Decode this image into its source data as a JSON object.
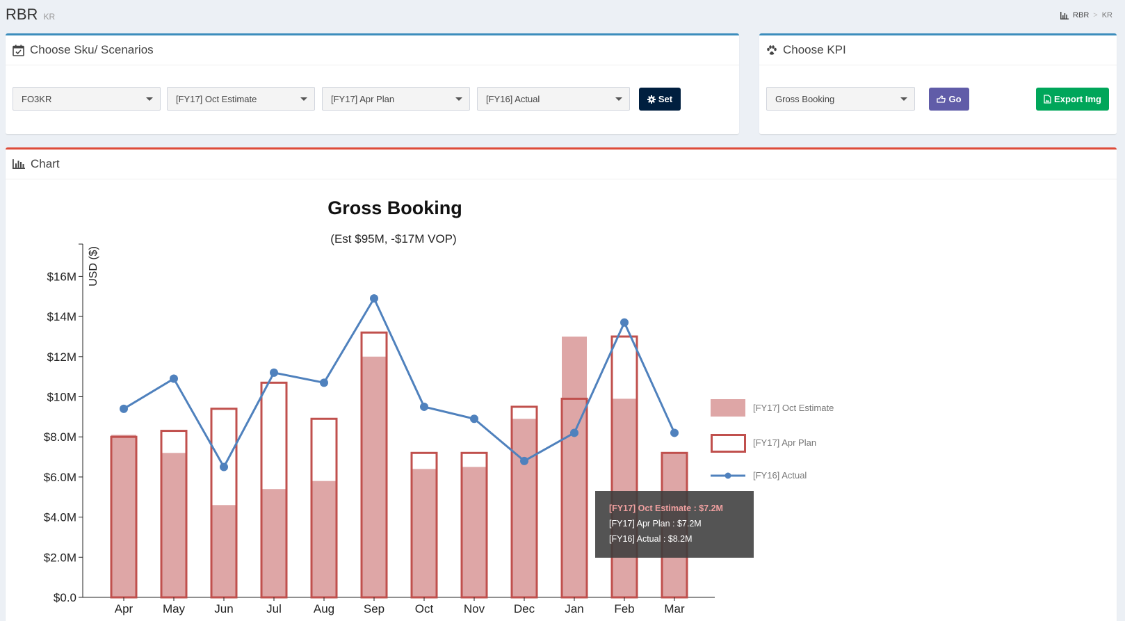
{
  "header": {
    "title": "RBR",
    "subtitle": "KR"
  },
  "breadcrumb": {
    "items": [
      "RBR",
      "KR"
    ]
  },
  "sku_panel": {
    "title": "Choose Sku/ Scenarios",
    "selects": [
      "FO3KR",
      "[FY17] Oct Estimate",
      "[FY17] Apr Plan",
      "[FY16] Actual"
    ],
    "set_label": "Set"
  },
  "kpi_panel": {
    "title": "Choose KPI",
    "select": "Gross Booking",
    "go_label": "Go",
    "export_label": "Export Img"
  },
  "chart_panel": {
    "title": "Chart"
  },
  "colors": {
    "estimate": "#dea6a6",
    "plan": "#c0504d",
    "actual": "#4f81bd",
    "primary": "#3c8dbc",
    "danger": "#dd4b39"
  },
  "tooltip": {
    "line1": "[FY17] Oct Estimate : $7.2M",
    "line2": "[FY17] Apr Plan : $7.2M",
    "line3": "[FY16] Actual : $8.2M"
  },
  "chart_data": {
    "type": "bar",
    "title": "Gross Booking",
    "subtitle": "(Est $95M, -$17M VOP)",
    "ylabel": "USD ($)",
    "xlabel": "",
    "ylim": [
      0,
      17
    ],
    "yticks": [
      0,
      2,
      4,
      6,
      8,
      10,
      12,
      14,
      16
    ],
    "ytick_labels": [
      "$0.0",
      "$2.0M",
      "$4.0M",
      "$6.0M",
      "$8.0M",
      "$10M",
      "$12M",
      "$14M",
      "$16M"
    ],
    "categories": [
      "Apr",
      "May",
      "Jun",
      "Jul",
      "Aug",
      "Sep",
      "Oct",
      "Nov",
      "Dec",
      "Jan",
      "Feb",
      "Mar"
    ],
    "series": [
      {
        "name": "[FY17] Oct Estimate",
        "type": "bar",
        "values": [
          8.1,
          7.2,
          4.6,
          5.4,
          5.8,
          12.0,
          6.4,
          6.5,
          8.9,
          13.0,
          9.9,
          7.2
        ]
      },
      {
        "name": "[FY17] Apr Plan",
        "type": "bar-outline",
        "values": [
          8.0,
          8.3,
          9.4,
          10.7,
          8.9,
          13.2,
          7.2,
          7.2,
          9.5,
          9.9,
          13.0,
          7.2
        ]
      },
      {
        "name": "[FY16] Actual",
        "type": "line",
        "values": [
          9.4,
          10.9,
          6.5,
          11.2,
          10.7,
          14.9,
          9.5,
          8.9,
          6.8,
          8.2,
          13.7,
          8.2
        ]
      }
    ],
    "legend_position": "right",
    "grid": false
  }
}
